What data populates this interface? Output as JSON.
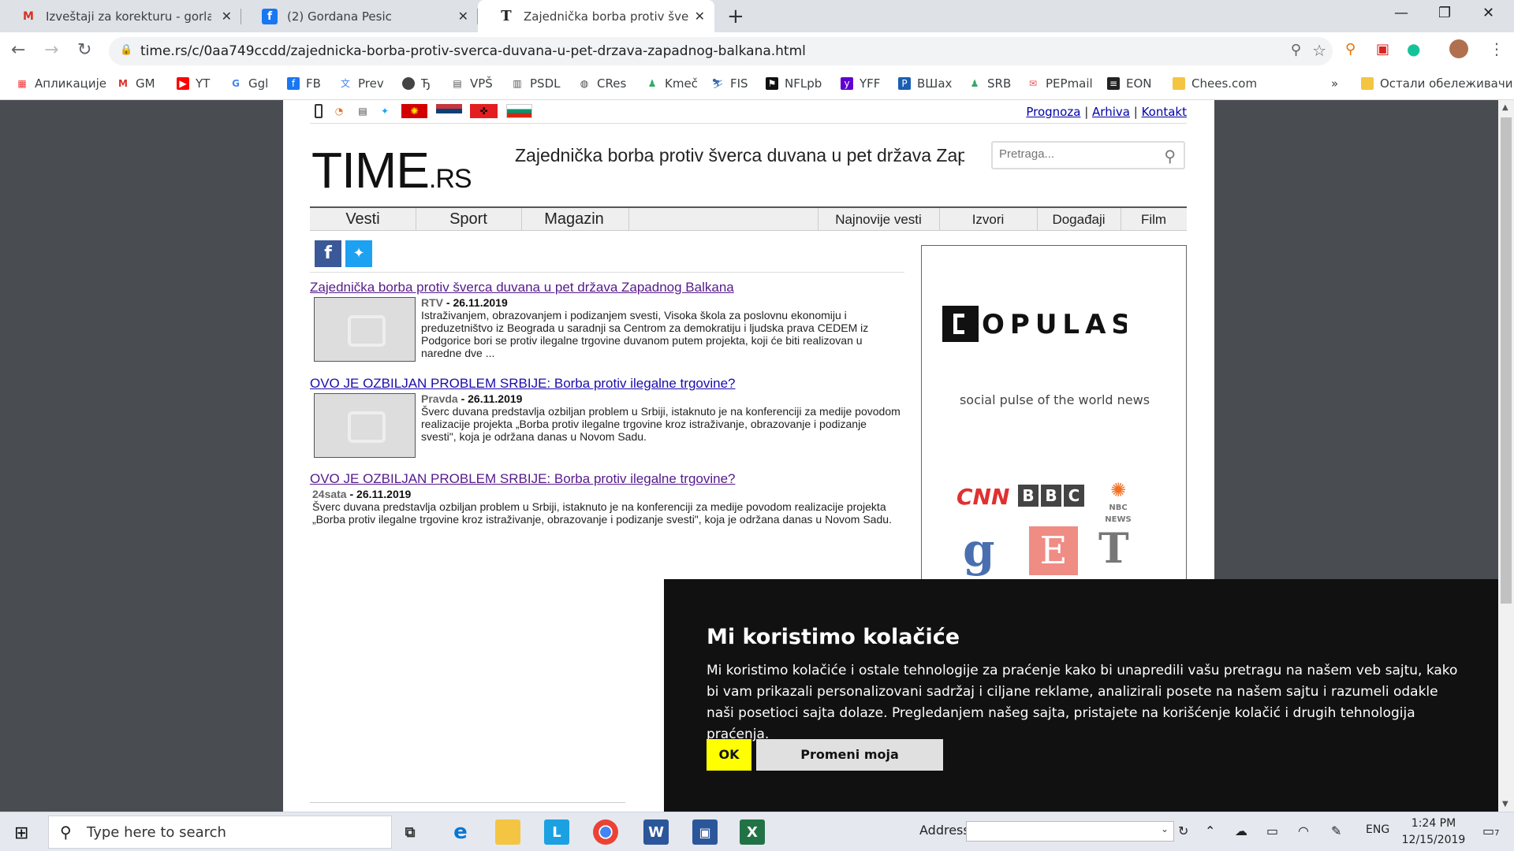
{
  "browser": {
    "tabs": [
      {
        "title": "Izveštaji za korekturu - gorlap@g",
        "icon": "gmail-icon"
      },
      {
        "title": "(2) Gordana Pesic",
        "icon": "facebook-icon"
      },
      {
        "title": "Zajednička borba protiv šverca d",
        "icon": "time-icon"
      }
    ],
    "url": "time.rs/c/0aa749ccdd/zajednicka-borba-protiv-sverca-duvana-u-pet-drzava-zapadnog-balkana.html",
    "bookmarks": [
      {
        "label": "Апликације"
      },
      {
        "label": "GM"
      },
      {
        "label": "YT"
      },
      {
        "label": "Ggl"
      },
      {
        "label": "FB"
      },
      {
        "label": "Prev"
      },
      {
        "label": "Ђ"
      },
      {
        "label": "VPŠ"
      },
      {
        "label": "PSDL"
      },
      {
        "label": "CRes"
      },
      {
        "label": "Kmeč"
      },
      {
        "label": "FIS"
      },
      {
        "label": "NFLpb"
      },
      {
        "label": "YFF"
      },
      {
        "label": "ВШах"
      },
      {
        "label": "SRB"
      },
      {
        "label": "PEPmail"
      },
      {
        "label": "EON"
      },
      {
        "label": "Chees.com"
      }
    ],
    "bookmarks_more": "»",
    "other_bookmarks": "Остали обележивачи"
  },
  "site": {
    "toplinks": [
      "Prognoza",
      "Arhiva",
      "Kontakt"
    ],
    "logo_main": "TIME",
    "logo_suffix": ".RS",
    "head_title": "Zajednička borba protiv šverca duvana u pet država Zapad...",
    "search_placeholder": "Pretraga...",
    "menu_main": [
      "Vesti",
      "Sport",
      "Magazin"
    ],
    "menu_secondary": [
      "Najnovije vesti",
      "Izvori",
      "Događaji",
      "Film"
    ],
    "articles": [
      {
        "title": "Zajednička borba protiv šverca duvana u pet država Zapadnog Balkana",
        "source": "RTV",
        "date": " - 26.11.2019",
        "body": "Istraživanjem, obrazovanjem i podizanjem svesti, Visoka škola za poslovnu ekonomiju i preduzetništvo iz Beograda u saradnji sa Centrom za demokratiju i ljudska prava CEDEM iz Podgorice bori se protiv ilegalne trgovine duvanom putem projekta, koji će biti realizovan u naredne dve ..."
      },
      {
        "title": "OVO JE OZBILJAN PROBLEM SRBIJE: Borba protiv ilegalne trgovine?",
        "source": "Pravda",
        "date": " - 26.11.2019",
        "body": "Šverc duvana predstavlja ozbiljan problem u Srbiji, istaknuto je na konferenciji za medije povodom realizacije projekta „Borba protiv ilegalne trgovine kroz istraživanje, obrazovanje i podizanje svesti\", koja je održana danas u Novom Sadu."
      },
      {
        "title": "OVO JE OZBILJAN PROBLEM SRBIJE: Borba protiv ilegalne trgovine?",
        "source": "24sata",
        "date": " - 26.11.2019",
        "body": "Šverc duvana predstavlja ozbiljan problem u Srbiji, istaknuto je na konferenciji za medije povodom realizacije projekta „Borba protiv ilegalne trgovine kroz istraživanje, obrazovanje i podizanje svesti\", koja je održana danas u Novom Sadu."
      }
    ],
    "ad": {
      "brand": "POPULAST",
      "tagline": "social pulse of the world news",
      "logos": [
        "CNN",
        "BBC",
        "NBC NEWS",
        "g",
        "E",
        "T"
      ]
    }
  },
  "cookie": {
    "title": "Mi koristimo kolačiće",
    "text": "Mi koristimo kolačiće i ostale tehnologije za praćenje kako bi unapredili vašu pretragu na našem veb sajtu, kako bi vam prikazali personalizovani sadržaj i ciljane reklame, analizirali posete na našem sajtu i razumeli odakle naši posetioci sajta dolaze. Pregledanjem našeg sajta, pristajete na korišćenje kolačić i drugih tehnologija praćenja.",
    "ok": "OK",
    "settings": "Promeni moja podešavanja"
  },
  "taskbar": {
    "search_placeholder": "Type here to search",
    "address_label": "Address",
    "language": "ENG",
    "time": "1:24 PM",
    "date": "12/15/2019",
    "notifications": "7"
  },
  "colors": {
    "tab_strip": "#dee1e6",
    "page_bg": "#494c50",
    "cookie_bg": "#111111",
    "ok_button": "#ffff00",
    "link_visited": "#551a8b",
    "link": "#1a0dab"
  }
}
